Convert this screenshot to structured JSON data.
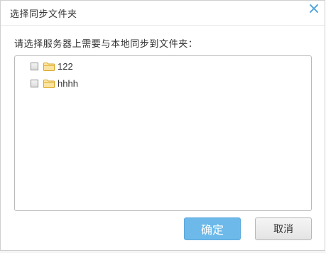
{
  "dialog": {
    "title": "选择同步文件夹",
    "close_icon": "close-icon",
    "prompt": "请选择服务器上需要与本地同步到文件夹："
  },
  "tree": {
    "items": [
      {
        "label": "122",
        "checked": false,
        "icon": "folder-icon"
      },
      {
        "label": "hhhh",
        "checked": false,
        "icon": "folder-icon"
      }
    ]
  },
  "buttons": {
    "ok_label": "确定",
    "cancel_label": "取消"
  },
  "colors": {
    "accent": "#6cb9ea",
    "close": "#5aa8dc",
    "folder": "#f3c24c"
  }
}
